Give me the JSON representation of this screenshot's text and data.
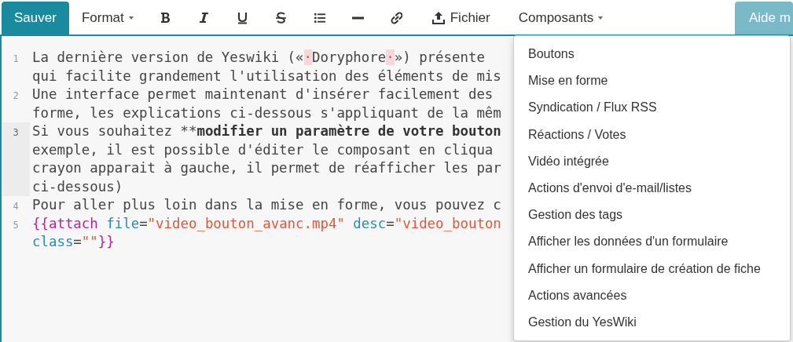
{
  "toolbar": {
    "save_button": "Sauver",
    "format_menu": "Format",
    "tools": [
      {
        "kind": "bold"
      },
      {
        "kind": "italic"
      },
      {
        "kind": "underline"
      },
      {
        "kind": "strike"
      },
      {
        "kind": "list"
      },
      {
        "kind": "rule"
      },
      {
        "kind": "link"
      }
    ],
    "file_button": "Fichier",
    "components_menu": {
      "label": "Composants",
      "expanded": true
    },
    "help_button": "Aide m"
  },
  "editor": {
    "lines": [
      {
        "number": "1",
        "active": false,
        "rows": [
          {
            "segments": [
              {
                "kind": "text",
                "text": "La dernière version de Yeswiki («"
              },
              {
                "kind": "special",
                "text": "·"
              },
              {
                "kind": "text",
                "text": "Doryphore"
              },
              {
                "kind": "special",
                "text": "·"
              },
              {
                "kind": "text",
                "text": "») présente"
              }
            ]
          },
          {
            "segments": [
              {
                "kind": "text",
                "text": "qui facilite grandement l'utilisation des éléments de mis"
              }
            ]
          }
        ]
      },
      {
        "number": "2",
        "active": false,
        "rows": [
          {
            "segments": [
              {
                "kind": "text",
                "text": "Une interface permet maintenant d'insérer facilement des"
              }
            ]
          },
          {
            "segments": [
              {
                "kind": "text",
                "text": "forme, les explications ci-dessous s'appliquant de la mêm"
              }
            ]
          }
        ]
      },
      {
        "number": "3",
        "active": true,
        "rows": [
          {
            "segments": [
              {
                "kind": "text",
                "text": "Si vous souhaitez **"
              },
              {
                "kind": "bold",
                "text": "modifier un paramètre de votre bouton"
              }
            ]
          },
          {
            "segments": [
              {
                "kind": "text",
                "text": "exemple, il est possible d'éditer le composant en cliqua"
              }
            ]
          },
          {
            "segments": [
              {
                "kind": "text",
                "text": "crayon apparait à gauche, il permet de réafficher les par"
              }
            ]
          },
          {
            "segments": [
              {
                "kind": "text",
                "text": "ci-dessous)"
              }
            ]
          }
        ]
      },
      {
        "number": "4",
        "active": false,
        "rows": [
          {
            "segments": [
              {
                "kind": "text",
                "text": "Pour aller plus loin dans la mise en forme, vous pouvez c"
              }
            ]
          }
        ]
      },
      {
        "number": "5",
        "active": false,
        "rows": [
          {
            "segments": [
              {
                "kind": "tag",
                "text": "{{attach"
              },
              {
                "kind": "attr",
                "text": " file"
              },
              {
                "kind": "text",
                "text": "="
              },
              {
                "kind": "string",
                "text": "\"video_bouton_avanc.mp4\""
              },
              {
                "kind": "attr",
                "text": " desc"
              },
              {
                "kind": "text",
                "text": "="
              },
              {
                "kind": "string",
                "text": "\"video_bouton"
              }
            ]
          },
          {
            "segments": [
              {
                "kind": "attr",
                "text": "class"
              },
              {
                "kind": "text",
                "text": "="
              },
              {
                "kind": "string",
                "text": "\"\""
              },
              {
                "kind": "tag",
                "text": "}}"
              }
            ]
          }
        ]
      }
    ]
  },
  "components_dropdown": [
    "Boutons",
    "Mise en forme",
    "Syndication / Flux RSS",
    "Réactions / Votes",
    "Vidéo intégrée",
    "Actions d'envoi d'e-mail/listes",
    "Gestion des tags",
    "Afficher les données d'un formulaire",
    "Afficher un formulaire de création de fiche",
    "Actions avancées",
    "Gestion du YesWiki"
  ]
}
